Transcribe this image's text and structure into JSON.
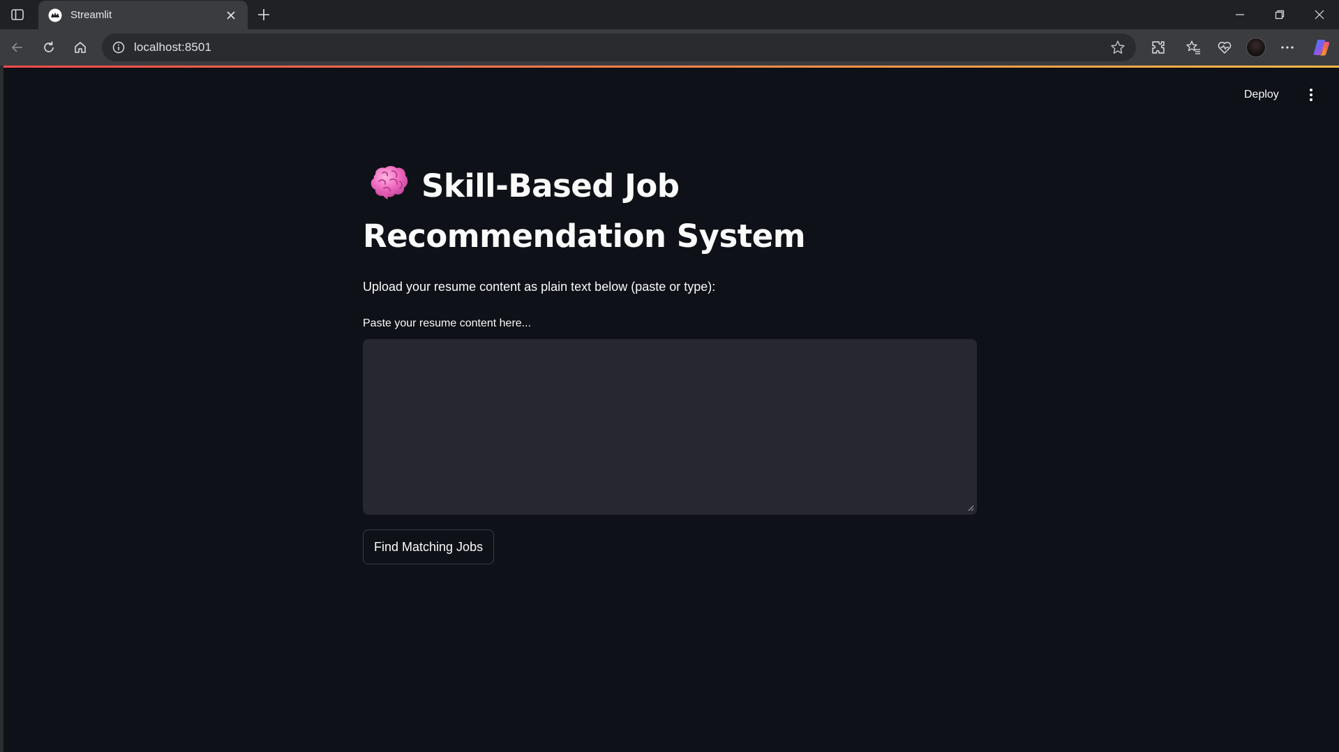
{
  "browser": {
    "tab_title": "Streamlit",
    "url": "localhost:8501"
  },
  "app": {
    "deploy_label": "Deploy",
    "title_line1": "Skill-Based Job",
    "title_line2": "Recommendation System",
    "subtitle": "Upload your resume content as plain text below (paste or type):",
    "textarea_label": "Paste your resume content here...",
    "textarea_value": "",
    "button_label": "Find Matching Jobs"
  },
  "colors": {
    "page_bg": "#0e1117",
    "input_bg": "#262730",
    "text": "#fafafa",
    "accent_start": "#ff4b4b",
    "accent_end": "#ffbd45"
  }
}
